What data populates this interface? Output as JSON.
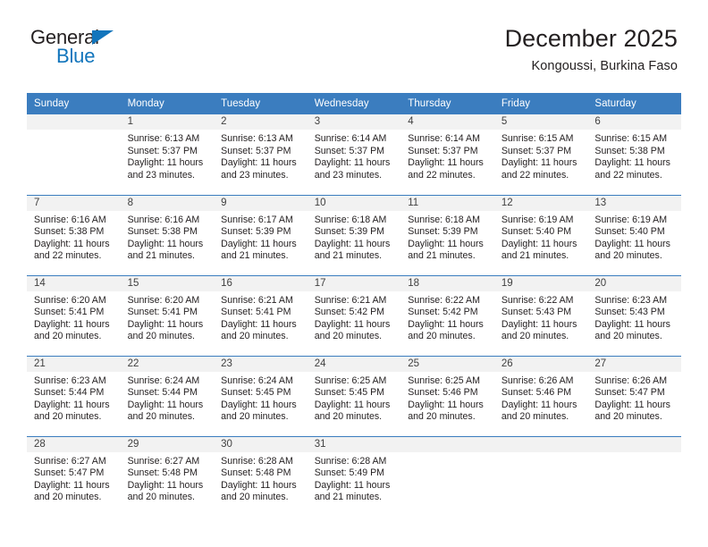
{
  "brand": {
    "name_top": "General",
    "name_bottom": "Blue",
    "accent_color": "#1275bc"
  },
  "header": {
    "title": "December 2025",
    "location": "Kongoussi, Burkina Faso"
  },
  "calendar": {
    "header_bg": "#3b7dbf",
    "daynum_bg": "#f2f2f2",
    "weekday_headers": [
      "Sunday",
      "Monday",
      "Tuesday",
      "Wednesday",
      "Thursday",
      "Friday",
      "Saturday"
    ],
    "weeks": [
      [
        {
          "day": "",
          "sunrise": "",
          "sunset": "",
          "daylight_1": "",
          "daylight_2": ""
        },
        {
          "day": "1",
          "sunrise": "Sunrise: 6:13 AM",
          "sunset": "Sunset: 5:37 PM",
          "daylight_1": "Daylight: 11 hours",
          "daylight_2": "and 23 minutes."
        },
        {
          "day": "2",
          "sunrise": "Sunrise: 6:13 AM",
          "sunset": "Sunset: 5:37 PM",
          "daylight_1": "Daylight: 11 hours",
          "daylight_2": "and 23 minutes."
        },
        {
          "day": "3",
          "sunrise": "Sunrise: 6:14 AM",
          "sunset": "Sunset: 5:37 PM",
          "daylight_1": "Daylight: 11 hours",
          "daylight_2": "and 23 minutes."
        },
        {
          "day": "4",
          "sunrise": "Sunrise: 6:14 AM",
          "sunset": "Sunset: 5:37 PM",
          "daylight_1": "Daylight: 11 hours",
          "daylight_2": "and 22 minutes."
        },
        {
          "day": "5",
          "sunrise": "Sunrise: 6:15 AM",
          "sunset": "Sunset: 5:37 PM",
          "daylight_1": "Daylight: 11 hours",
          "daylight_2": "and 22 minutes."
        },
        {
          "day": "6",
          "sunrise": "Sunrise: 6:15 AM",
          "sunset": "Sunset: 5:38 PM",
          "daylight_1": "Daylight: 11 hours",
          "daylight_2": "and 22 minutes."
        }
      ],
      [
        {
          "day": "7",
          "sunrise": "Sunrise: 6:16 AM",
          "sunset": "Sunset: 5:38 PM",
          "daylight_1": "Daylight: 11 hours",
          "daylight_2": "and 22 minutes."
        },
        {
          "day": "8",
          "sunrise": "Sunrise: 6:16 AM",
          "sunset": "Sunset: 5:38 PM",
          "daylight_1": "Daylight: 11 hours",
          "daylight_2": "and 21 minutes."
        },
        {
          "day": "9",
          "sunrise": "Sunrise: 6:17 AM",
          "sunset": "Sunset: 5:39 PM",
          "daylight_1": "Daylight: 11 hours",
          "daylight_2": "and 21 minutes."
        },
        {
          "day": "10",
          "sunrise": "Sunrise: 6:18 AM",
          "sunset": "Sunset: 5:39 PM",
          "daylight_1": "Daylight: 11 hours",
          "daylight_2": "and 21 minutes."
        },
        {
          "day": "11",
          "sunrise": "Sunrise: 6:18 AM",
          "sunset": "Sunset: 5:39 PM",
          "daylight_1": "Daylight: 11 hours",
          "daylight_2": "and 21 minutes."
        },
        {
          "day": "12",
          "sunrise": "Sunrise: 6:19 AM",
          "sunset": "Sunset: 5:40 PM",
          "daylight_1": "Daylight: 11 hours",
          "daylight_2": "and 21 minutes."
        },
        {
          "day": "13",
          "sunrise": "Sunrise: 6:19 AM",
          "sunset": "Sunset: 5:40 PM",
          "daylight_1": "Daylight: 11 hours",
          "daylight_2": "and 20 minutes."
        }
      ],
      [
        {
          "day": "14",
          "sunrise": "Sunrise: 6:20 AM",
          "sunset": "Sunset: 5:41 PM",
          "daylight_1": "Daylight: 11 hours",
          "daylight_2": "and 20 minutes."
        },
        {
          "day": "15",
          "sunrise": "Sunrise: 6:20 AM",
          "sunset": "Sunset: 5:41 PM",
          "daylight_1": "Daylight: 11 hours",
          "daylight_2": "and 20 minutes."
        },
        {
          "day": "16",
          "sunrise": "Sunrise: 6:21 AM",
          "sunset": "Sunset: 5:41 PM",
          "daylight_1": "Daylight: 11 hours",
          "daylight_2": "and 20 minutes."
        },
        {
          "day": "17",
          "sunrise": "Sunrise: 6:21 AM",
          "sunset": "Sunset: 5:42 PM",
          "daylight_1": "Daylight: 11 hours",
          "daylight_2": "and 20 minutes."
        },
        {
          "day": "18",
          "sunrise": "Sunrise: 6:22 AM",
          "sunset": "Sunset: 5:42 PM",
          "daylight_1": "Daylight: 11 hours",
          "daylight_2": "and 20 minutes."
        },
        {
          "day": "19",
          "sunrise": "Sunrise: 6:22 AM",
          "sunset": "Sunset: 5:43 PM",
          "daylight_1": "Daylight: 11 hours",
          "daylight_2": "and 20 minutes."
        },
        {
          "day": "20",
          "sunrise": "Sunrise: 6:23 AM",
          "sunset": "Sunset: 5:43 PM",
          "daylight_1": "Daylight: 11 hours",
          "daylight_2": "and 20 minutes."
        }
      ],
      [
        {
          "day": "21",
          "sunrise": "Sunrise: 6:23 AM",
          "sunset": "Sunset: 5:44 PM",
          "daylight_1": "Daylight: 11 hours",
          "daylight_2": "and 20 minutes."
        },
        {
          "day": "22",
          "sunrise": "Sunrise: 6:24 AM",
          "sunset": "Sunset: 5:44 PM",
          "daylight_1": "Daylight: 11 hours",
          "daylight_2": "and 20 minutes."
        },
        {
          "day": "23",
          "sunrise": "Sunrise: 6:24 AM",
          "sunset": "Sunset: 5:45 PM",
          "daylight_1": "Daylight: 11 hours",
          "daylight_2": "and 20 minutes."
        },
        {
          "day": "24",
          "sunrise": "Sunrise: 6:25 AM",
          "sunset": "Sunset: 5:45 PM",
          "daylight_1": "Daylight: 11 hours",
          "daylight_2": "and 20 minutes."
        },
        {
          "day": "25",
          "sunrise": "Sunrise: 6:25 AM",
          "sunset": "Sunset: 5:46 PM",
          "daylight_1": "Daylight: 11 hours",
          "daylight_2": "and 20 minutes."
        },
        {
          "day": "26",
          "sunrise": "Sunrise: 6:26 AM",
          "sunset": "Sunset: 5:46 PM",
          "daylight_1": "Daylight: 11 hours",
          "daylight_2": "and 20 minutes."
        },
        {
          "day": "27",
          "sunrise": "Sunrise: 6:26 AM",
          "sunset": "Sunset: 5:47 PM",
          "daylight_1": "Daylight: 11 hours",
          "daylight_2": "and 20 minutes."
        }
      ],
      [
        {
          "day": "28",
          "sunrise": "Sunrise: 6:27 AM",
          "sunset": "Sunset: 5:47 PM",
          "daylight_1": "Daylight: 11 hours",
          "daylight_2": "and 20 minutes."
        },
        {
          "day": "29",
          "sunrise": "Sunrise: 6:27 AM",
          "sunset": "Sunset: 5:48 PM",
          "daylight_1": "Daylight: 11 hours",
          "daylight_2": "and 20 minutes."
        },
        {
          "day": "30",
          "sunrise": "Sunrise: 6:28 AM",
          "sunset": "Sunset: 5:48 PM",
          "daylight_1": "Daylight: 11 hours",
          "daylight_2": "and 20 minutes."
        },
        {
          "day": "31",
          "sunrise": "Sunrise: 6:28 AM",
          "sunset": "Sunset: 5:49 PM",
          "daylight_1": "Daylight: 11 hours",
          "daylight_2": "and 21 minutes."
        },
        {
          "day": "",
          "sunrise": "",
          "sunset": "",
          "daylight_1": "",
          "daylight_2": ""
        },
        {
          "day": "",
          "sunrise": "",
          "sunset": "",
          "daylight_1": "",
          "daylight_2": ""
        },
        {
          "day": "",
          "sunrise": "",
          "sunset": "",
          "daylight_1": "",
          "daylight_2": ""
        }
      ]
    ]
  }
}
